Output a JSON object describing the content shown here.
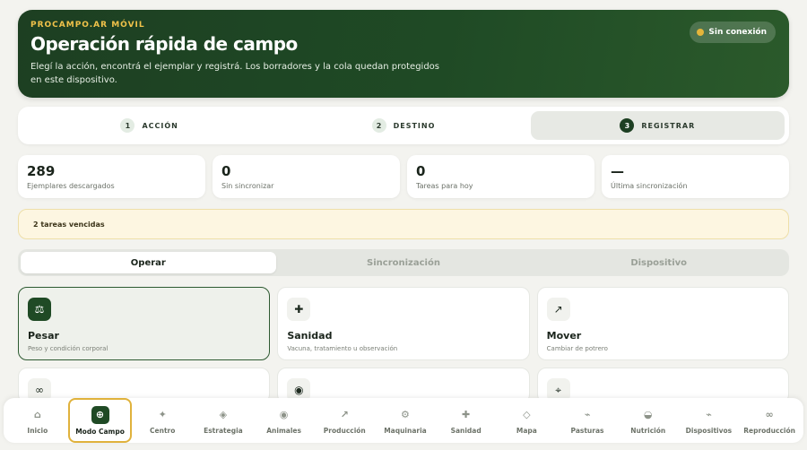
{
  "hero": {
    "eyebrow": "PROCAMPO.AR MÓVIL",
    "title": "Operación rápida de campo",
    "description": "Elegí la acción, encontrá el ejemplar y registrá. Los borradores y la cola quedan protegidos en este dispositivo.",
    "connection": "Sin conexión"
  },
  "steps": [
    {
      "num": "1",
      "label": "ACCIÓN"
    },
    {
      "num": "2",
      "label": "DESTINO"
    },
    {
      "num": "3",
      "label": "REGISTRAR"
    }
  ],
  "stats": [
    {
      "value": "289",
      "label": "Ejemplares descargados"
    },
    {
      "value": "0",
      "label": "Sin sincronizar"
    },
    {
      "value": "0",
      "label": "Tareas para hoy"
    },
    {
      "value": "—",
      "label": "Última sincronización"
    }
  ],
  "alert": "2 tareas vencidas",
  "tabs": [
    "Operar",
    "Sincronización",
    "Dispositivo"
  ],
  "actions": [
    {
      "icon": "⚖",
      "title": "Pesar",
      "subtitle": "Peso y condición corporal"
    },
    {
      "icon": "✚",
      "title": "Sanidad",
      "subtitle": "Vacuna, tratamiento u observación"
    },
    {
      "icon": "↗",
      "title": "Mover",
      "subtitle": "Cambiar de potrero"
    },
    {
      "icon": "∞"
    },
    {
      "icon": "◉"
    },
    {
      "icon": "⌖"
    }
  ],
  "nav": [
    {
      "icon": "⌂",
      "label": "Inicio"
    },
    {
      "icon": "⊕",
      "label": "Modo Campo"
    },
    {
      "icon": "✦",
      "label": "Centro"
    },
    {
      "icon": "◈",
      "label": "Estrategia"
    },
    {
      "icon": "◉",
      "label": "Animales"
    },
    {
      "icon": "↗",
      "label": "Producción"
    },
    {
      "icon": "⚙",
      "label": "Maquinaria"
    },
    {
      "icon": "✚",
      "label": "Sanidad"
    },
    {
      "icon": "◇",
      "label": "Mapa"
    },
    {
      "icon": "⌁",
      "label": "Pasturas"
    },
    {
      "icon": "◒",
      "label": "Nutrición"
    },
    {
      "icon": "⌁",
      "label": "Dispositivos"
    },
    {
      "icon": "∞",
      "label": "Reproducción"
    }
  ]
}
